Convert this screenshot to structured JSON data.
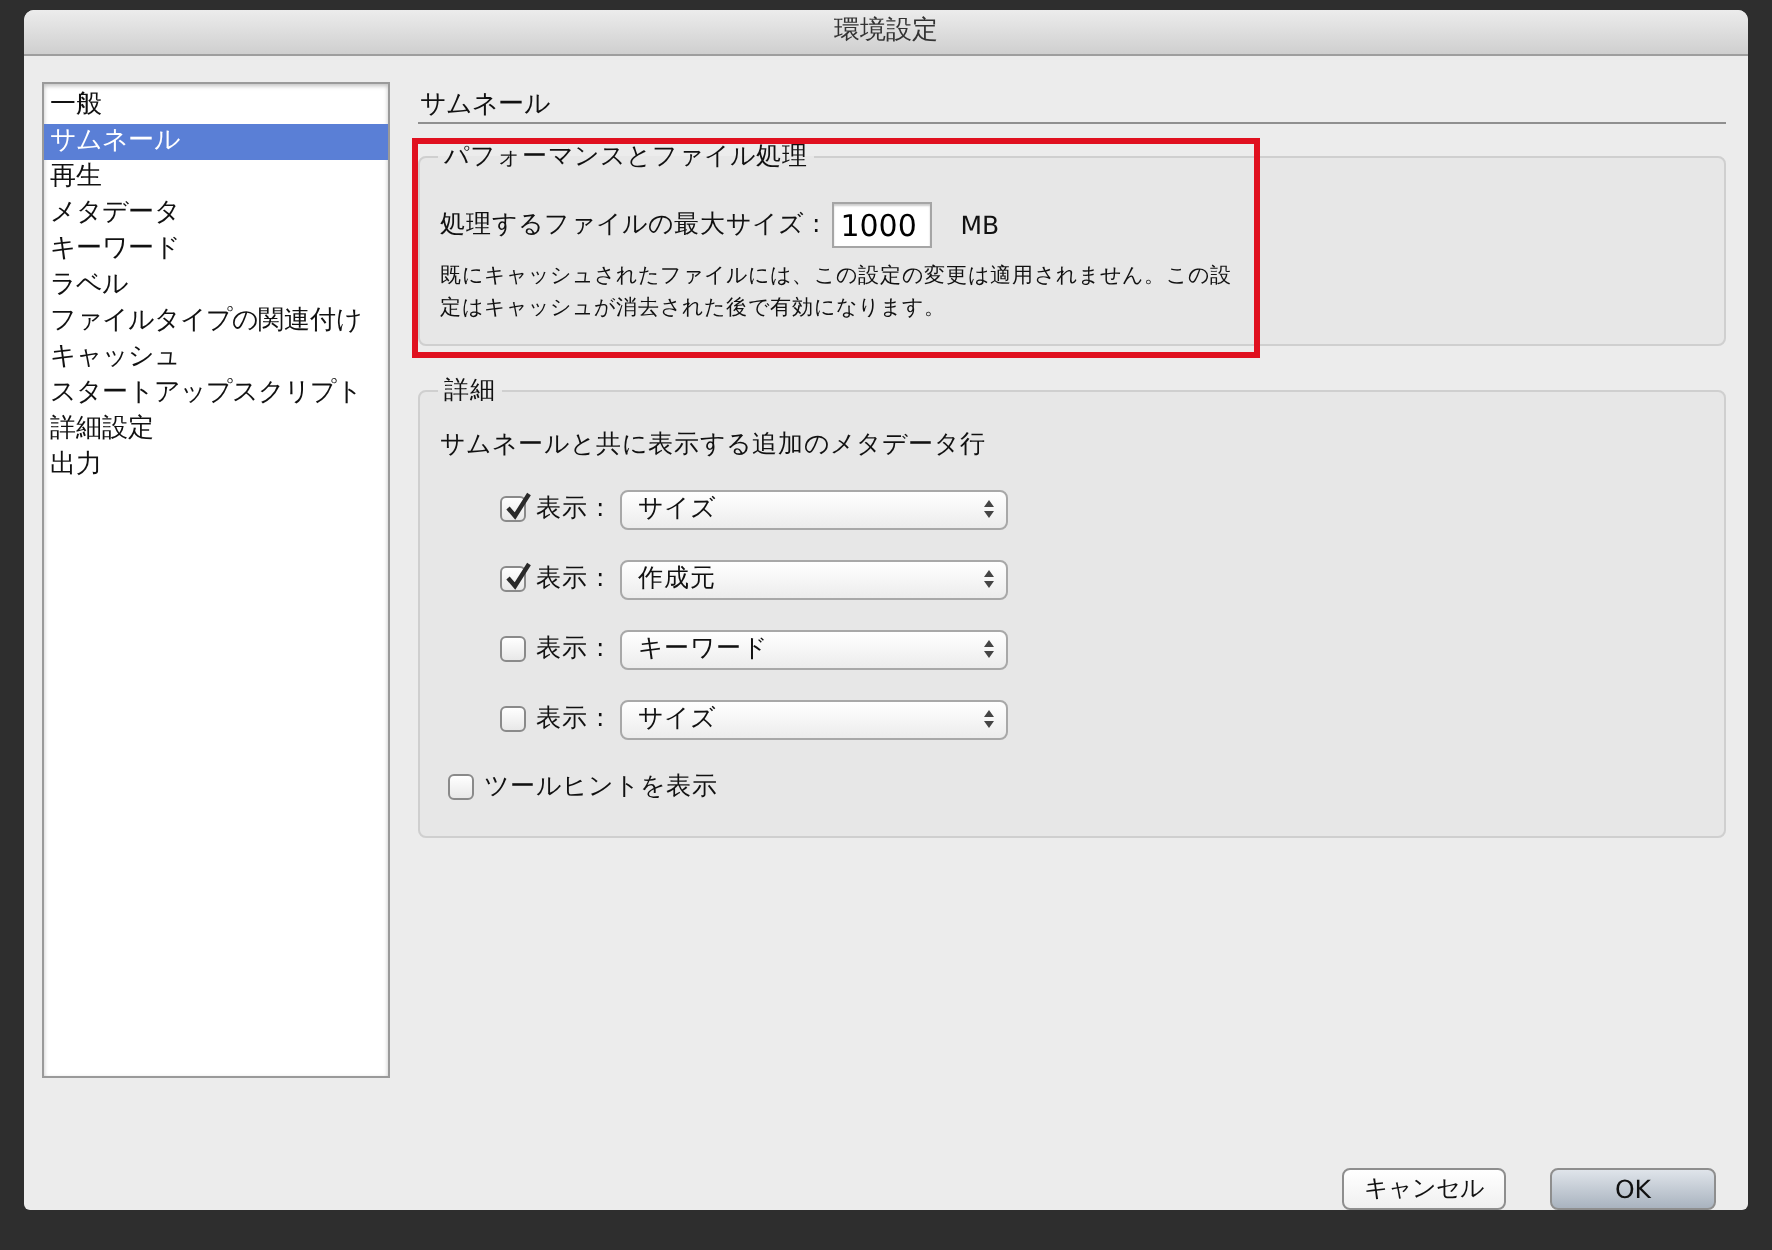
{
  "window": {
    "title": "環境設定"
  },
  "sidebar": {
    "items": [
      {
        "label": "一般",
        "selected": false
      },
      {
        "label": "サムネール",
        "selected": true
      },
      {
        "label": "再生",
        "selected": false
      },
      {
        "label": "メタデータ",
        "selected": false
      },
      {
        "label": "キーワード",
        "selected": false
      },
      {
        "label": "ラベル",
        "selected": false
      },
      {
        "label": "ファイルタイプの関連付け",
        "selected": false
      },
      {
        "label": "キャッシュ",
        "selected": false
      },
      {
        "label": "スタートアップスクリプト",
        "selected": false
      },
      {
        "label": "詳細設定",
        "selected": false
      },
      {
        "label": "出力",
        "selected": false
      }
    ]
  },
  "panel": {
    "title": "サムネール",
    "performance": {
      "title": "パフォーマンスとファイル処理",
      "highlighted": true,
      "max_size_label": "処理するファイルの最大サイズ :",
      "max_size_value": "1000",
      "max_size_unit": "MB",
      "note": "既にキャッシュされたファイルには、この設定の変更は適用されません。この設定はキャッシュが消去された後で有効になります。"
    },
    "details": {
      "title": "詳細",
      "metadata_label": "サムネールと共に表示する追加のメタデータ行",
      "rows": [
        {
          "checked": true,
          "label": "表示 :",
          "value": "サイズ"
        },
        {
          "checked": true,
          "label": "表示 :",
          "value": "作成元"
        },
        {
          "checked": false,
          "label": "表示 :",
          "value": "キーワード"
        },
        {
          "checked": false,
          "label": "表示 :",
          "value": "サイズ"
        }
      ],
      "tooltip": {
        "label": "ツールヒントを表示",
        "checked": false
      }
    }
  },
  "buttons": [
    {
      "label": "キャンセル",
      "kind": "cancel"
    },
    {
      "label": "OK",
      "kind": "default"
    }
  ]
}
